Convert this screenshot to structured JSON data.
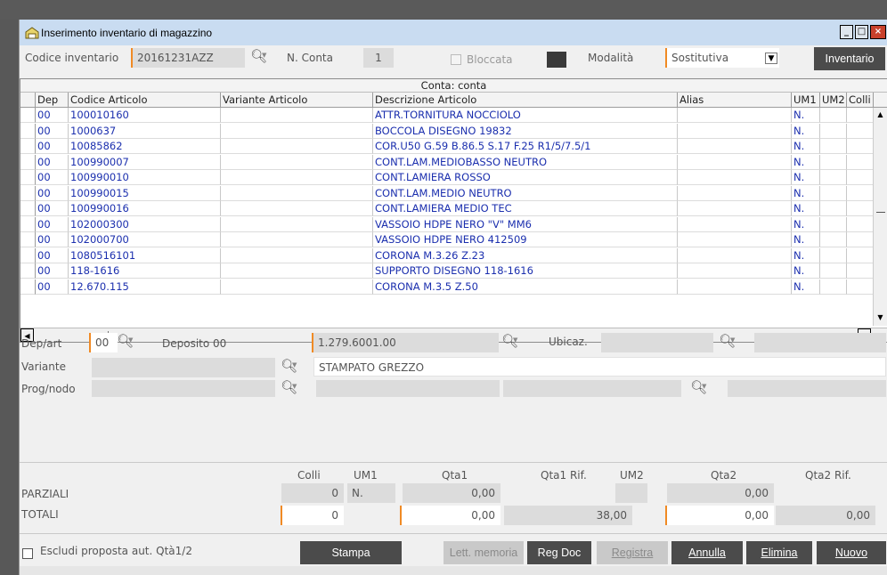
{
  "window": {
    "title": "Inserimento inventario di magazzino",
    "controls": [
      "_",
      "□",
      "×"
    ]
  },
  "header": {
    "codice_label": "Codice inventario",
    "codice_value": "20161231AZZ",
    "nconta_label": "N. Conta",
    "nconta_value": "1",
    "bloccata_label": "Bloccata",
    "modalita_label": "Modalità",
    "modalita_value": "Sostitutiva",
    "inventario_button": "Inventario"
  },
  "grid": {
    "caption": "Conta: conta",
    "columns": [
      "Dep",
      "Codice Articolo",
      "Variante Articolo",
      "Descrizione Articolo",
      "Alias",
      "UM1",
      "UM2",
      "Colli"
    ],
    "rows": [
      {
        "dep": "00",
        "codice": "100010160",
        "variante": "",
        "descrizione": "ATTR.TORNITURA NOCCIOLO",
        "alias": "",
        "um1": "N.",
        "um2": "",
        "colli": ""
      },
      {
        "dep": "00",
        "codice": "1000637",
        "variante": "",
        "descrizione": "BOCCOLA DISEGNO 19832",
        "alias": "",
        "um1": "N.",
        "um2": "",
        "colli": ""
      },
      {
        "dep": "00",
        "codice": "10085862",
        "variante": "",
        "descrizione": "COR.U50 G.59 B.86.5 S.17 F.25 R1/5/7.5/1",
        "alias": "",
        "um1": "N.",
        "um2": "",
        "colli": ""
      },
      {
        "dep": "00",
        "codice": "100990007",
        "variante": "",
        "descrizione": "CONT.LAM.MEDIOBASSO  NEUTRO",
        "alias": "",
        "um1": "N.",
        "um2": "",
        "colli": ""
      },
      {
        "dep": "00",
        "codice": "100990010",
        "variante": "",
        "descrizione": "CONT.LAMIERA ROSSO",
        "alias": "",
        "um1": "N.",
        "um2": "",
        "colli": ""
      },
      {
        "dep": "00",
        "codice": "100990015",
        "variante": "",
        "descrizione": "CONT.LAM.MEDIO NEUTRO",
        "alias": "",
        "um1": "N.",
        "um2": "",
        "colli": ""
      },
      {
        "dep": "00",
        "codice": "100990016",
        "variante": "",
        "descrizione": "CONT.LAMIERA MEDIO TEC",
        "alias": "",
        "um1": "N.",
        "um2": "",
        "colli": ""
      },
      {
        "dep": "00",
        "codice": "102000300",
        "variante": "",
        "descrizione": "VASSOIO HDPE NERO \"V\" MM6",
        "alias": "",
        "um1": "N.",
        "um2": "",
        "colli": ""
      },
      {
        "dep": "00",
        "codice": "102000700",
        "variante": "",
        "descrizione": "VASSOIO HDPE NERO 412509",
        "alias": "",
        "um1": "N.",
        "um2": "",
        "colli": ""
      },
      {
        "dep": "00",
        "codice": "1080516101",
        "variante": "",
        "descrizione": "CORONA M.3.26 Z.23",
        "alias": "",
        "um1": "N.",
        "um2": "",
        "colli": ""
      },
      {
        "dep": "00",
        "codice": "118-1616",
        "variante": "",
        "descrizione": "SUPPORTO DISEGNO 118-1616",
        "alias": "",
        "um1": "N.",
        "um2": "",
        "colli": ""
      },
      {
        "dep": "00",
        "codice": "12.670.115",
        "variante": "",
        "descrizione": "CORONA M.3.5 Z.50",
        "alias": "",
        "um1": "N.",
        "um2": "",
        "colli": ""
      }
    ]
  },
  "detail": {
    "depart_label": "Dep/art",
    "dep_value": "00",
    "deposito_text": "Deposito 00",
    "articolo_value": "1.279.6001.00",
    "ubicaz_label": "Ubicaz.",
    "variante_label": "Variante",
    "variante_desc": "STAMPATO GREZZO",
    "prognodo_label": "Prog/nodo"
  },
  "totals": {
    "headers": {
      "colli": "Colli",
      "um1": "UM1",
      "qta1": "Qta1",
      "qta1rif": "Qta1 Rif.",
      "um2": "UM2",
      "qta2": "Qta2",
      "qta2rif": "Qta2 Rif."
    },
    "parziali": {
      "label": "PARZIALI",
      "colli": "0",
      "um1": "N.",
      "qta1": "0,00",
      "qta2": "0,00"
    },
    "totali": {
      "label": "TOTALI",
      "colli": "0",
      "qta1": "0,00",
      "qta1rif": "38,00",
      "qta2": "0,00",
      "qta2rif": "0,00"
    }
  },
  "footer": {
    "escludi_label": "Escludi proposta aut. Qtà1/2",
    "stampa": "Stampa",
    "lett_memoria": "Lett. memoria",
    "reg_doc": "Reg Doc",
    "registra": "Registra",
    "annulla": "Annulla",
    "elimina": "Elimina",
    "nuovo": "Nuovo"
  },
  "colors": {
    "accent": "#f08a24",
    "title_bar": "#c9dcf1",
    "button_dark": "#4b4b4b",
    "grid_text": "#1b2fae"
  }
}
